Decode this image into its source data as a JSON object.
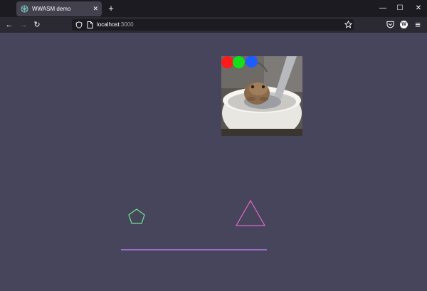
{
  "tab": {
    "title": "WWASM demo",
    "close_glyph": "✕"
  },
  "new_tab_glyph": "+",
  "window_controls": {
    "minimize": "—",
    "maximize": "☐",
    "close": "✕"
  },
  "nav": {
    "back": "←",
    "forward": "→",
    "reload": "↻"
  },
  "url": {
    "host": "localhost",
    "port": ":3000"
  },
  "icons": [
    "favicon-icon",
    "shield-icon",
    "page-icon",
    "star-icon",
    "pocket-icon",
    "account-icon",
    "menu-icon"
  ],
  "account_badge": "W",
  "menu_glyph": "≡",
  "canvas": {
    "background": "#46455c",
    "shapes": [
      {
        "type": "pentagon",
        "color": "#6ee58c"
      },
      {
        "type": "triangle",
        "color": "#e36ac8"
      },
      {
        "type": "line",
        "color": "#b57cf0"
      }
    ],
    "image_dots": [
      "#ff1a1a",
      "#14e01a",
      "#1f5cff"
    ]
  }
}
